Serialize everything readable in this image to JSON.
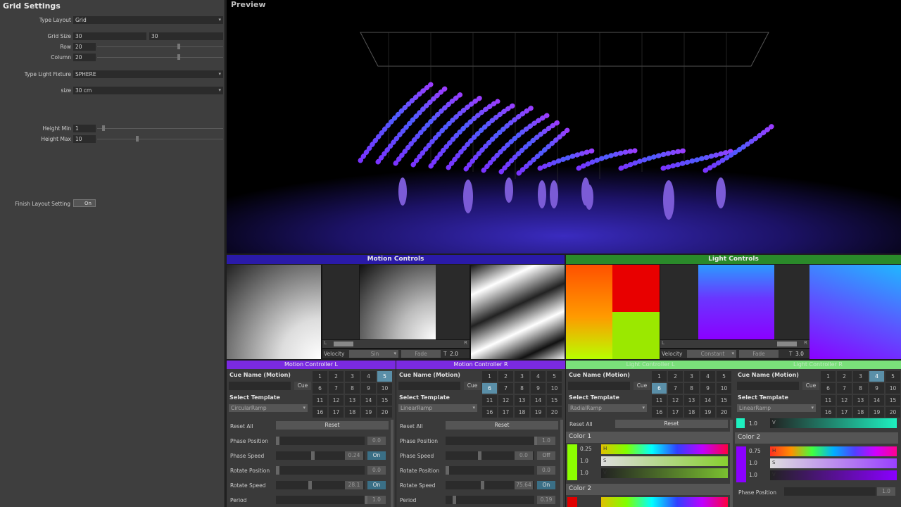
{
  "left_panel": {
    "title": "Grid Settings",
    "type_layout_label": "Type Layout",
    "type_layout_value": "Grid",
    "grid_size_label": "Grid Size",
    "grid_size_a": "30",
    "grid_size_b": "30",
    "row_label": "Row",
    "row_value": "20",
    "column_label": "Column",
    "column_value": "20",
    "light_fixture_label": "Type Light Fixture",
    "light_fixture_value": "SPHERE",
    "size_label": "size",
    "size_value": "30 cm",
    "height_min_label": "Height Min",
    "height_min_value": "1",
    "height_max_label": "Height Max",
    "height_max_value": "10",
    "finish_label": "Finish Layout Setting",
    "finish_value": "On"
  },
  "preview": {
    "title": "Preview"
  },
  "motion": {
    "title": "Motion Controls",
    "velocity_label": "Velocity",
    "velocity_value": "Sin",
    "fade_label": "Fade",
    "t_label": "T",
    "t_value": "2.0",
    "l": "L",
    "r": "R"
  },
  "light": {
    "title": "Light Controls",
    "velocity_label": "Velocity",
    "velocity_value": "Constant",
    "fade_label": "Fade",
    "t_label": "T",
    "t_value": "3.0",
    "l": "L",
    "r": "R"
  },
  "cue_numbers": [
    "1",
    "2",
    "3",
    "4",
    "5",
    "6",
    "7",
    "8",
    "9",
    "10",
    "11",
    "12",
    "13",
    "14",
    "15",
    "16",
    "17",
    "18",
    "19",
    "20"
  ],
  "ctrl_mL": {
    "title": "Motion Controller L",
    "cue_name": "Cue Name (Motion)",
    "cue_btn": "Cue",
    "template_label": "Select Template",
    "template_value": "CircularRamp",
    "selected": "5",
    "reset_label": "Reset All",
    "reset_btn": "Reset",
    "rows": [
      {
        "label": "Phase Position",
        "value": "0.0"
      },
      {
        "label": "Phase Speed",
        "value": "0.24",
        "toggle": "On"
      },
      {
        "label": "Rotate Position",
        "value": "0.0"
      },
      {
        "label": "Rotate Speed",
        "value": "28.1",
        "toggle": "On"
      },
      {
        "label": "Period",
        "value": "1.0"
      }
    ]
  },
  "ctrl_mR": {
    "title": "Motion Controller R",
    "cue_name": "Cue Name (Motion)",
    "cue_btn": "Cue",
    "template_label": "Select Template",
    "template_value": "LinearRamp",
    "selected": "6",
    "reset_label": "Reset All",
    "reset_btn": "Reset",
    "rows": [
      {
        "label": "Phase Position",
        "value": "1.0"
      },
      {
        "label": "Phase Speed",
        "value": "0.0",
        "toggle": "Off"
      },
      {
        "label": "Rotate Position",
        "value": "0.0"
      },
      {
        "label": "Rotate Speed",
        "value": "75.64",
        "toggle": "On"
      },
      {
        "label": "Period",
        "value": "0.19"
      }
    ]
  },
  "ctrl_lL": {
    "title": "Light Controller L",
    "cue_name": "Cue Name (Motion)",
    "cue_btn": "Cue",
    "template_label": "Select Template",
    "template_value": "RadialRamp",
    "selected": "6",
    "reset_label": "Reset All",
    "reset_btn": "Reset",
    "color1": "Color 1",
    "color2": "Color 2",
    "h_value": "0.25",
    "s_value": "1.0",
    "v_value": "1.0",
    "h": "H",
    "s": "S",
    "v": "V"
  },
  "ctrl_lR": {
    "title": "Light Controller R",
    "cue_name": "Cue Name (Motion)",
    "cue_btn": "Cue",
    "template_label": "Select Template",
    "template_value": "LinearRamp",
    "selected": "4",
    "top_value": "1.0",
    "v": "V",
    "color2": "Color 2",
    "h_value": "0.75",
    "s_value": "1.0",
    "v_value": "1.0",
    "h": "H",
    "s": "S",
    "phase_label": "Phase Position",
    "phase_value": "1.0"
  },
  "colors": {
    "motion_bar": "#2a1aa8",
    "light_bar": "#2a8a2a",
    "ctrl_motion": "#7a2ae0",
    "ctrl_light": "#7ae07a",
    "accent": "#5a8fa8"
  }
}
